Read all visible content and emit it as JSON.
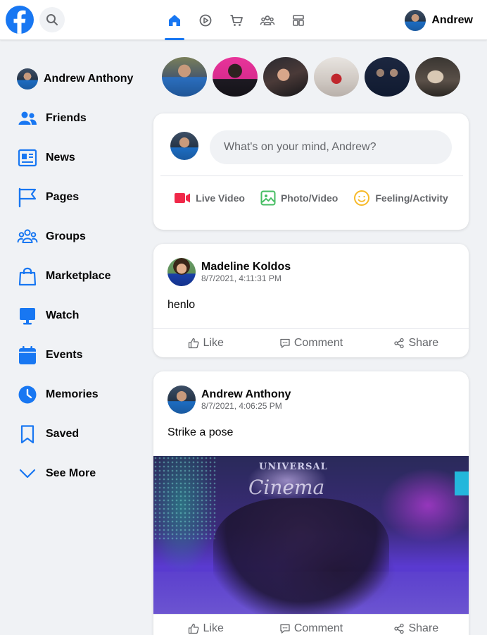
{
  "header": {
    "user_name": "Andrew",
    "nav": [
      "home-icon",
      "watch-icon",
      "marketplace-icon",
      "groups-icon",
      "gaming-icon"
    ],
    "accent": "#1877f2"
  },
  "sidebar": {
    "profile_name": "Andrew Anthony",
    "items": [
      {
        "label": "Friends",
        "icon": "friends-icon"
      },
      {
        "label": "News",
        "icon": "news-icon"
      },
      {
        "label": "Pages",
        "icon": "flag-icon"
      },
      {
        "label": "Groups",
        "icon": "groups-icon"
      },
      {
        "label": "Marketplace",
        "icon": "shopping-bag-icon"
      },
      {
        "label": "Watch",
        "icon": "monitor-icon"
      },
      {
        "label": "Events",
        "icon": "calendar-icon"
      },
      {
        "label": "Memories",
        "icon": "clock-icon"
      },
      {
        "label": "Saved",
        "icon": "bookmark-icon"
      },
      {
        "label": "See More",
        "icon": "chevron-down-icon"
      }
    ]
  },
  "composer": {
    "placeholder": "What's on your mind, Andrew?",
    "live_label": "Live Video",
    "photo_label": "Photo/Video",
    "feeling_label": "Feeling/Activity"
  },
  "posts": [
    {
      "author": "Madeline Koldos",
      "time": "8/7/2021, 4:11:31 PM",
      "text": "henlo",
      "like": "Like",
      "comment": "Comment",
      "share": "Share"
    },
    {
      "author": "Andrew Anthony",
      "time": "8/7/2021, 4:06:25 PM",
      "text": "Strike a pose",
      "like": "Like",
      "comment": "Comment",
      "share": "Share",
      "image_sign_top": "UNIVERSAL",
      "image_sign_script": "Cinema"
    }
  ]
}
